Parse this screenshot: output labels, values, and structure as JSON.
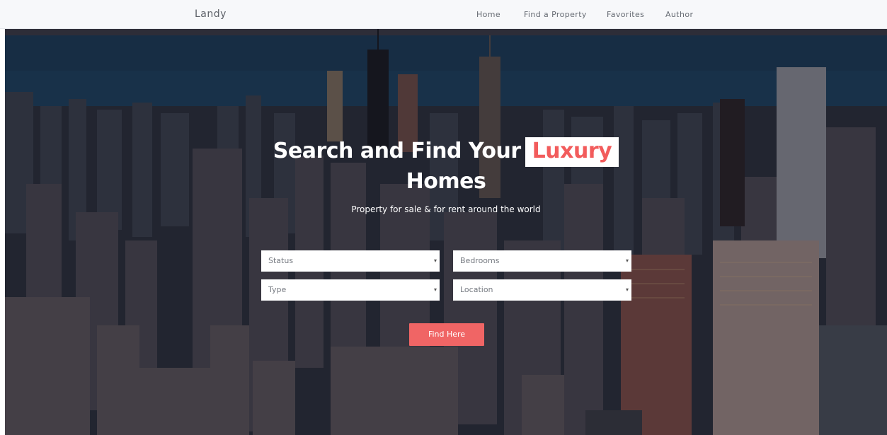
{
  "navbar": {
    "brand": "Landy",
    "links": [
      "Home",
      "Find a Property",
      "Favorites",
      "Author"
    ]
  },
  "hero": {
    "title_part1": "Search and Find Your",
    "title_highlight": "Luxury",
    "title_part2": "Homes",
    "subtitle": "Property for sale & for rent around the world"
  },
  "search_form": {
    "status": "Status",
    "bedrooms": "Bedrooms",
    "type": "Type",
    "location": "Location",
    "submit_label": "Find Here"
  },
  "colors": {
    "accent": "#f06565",
    "navbar_bg": "#f7f8fa"
  },
  "icons": {
    "dropdown": "▾"
  }
}
